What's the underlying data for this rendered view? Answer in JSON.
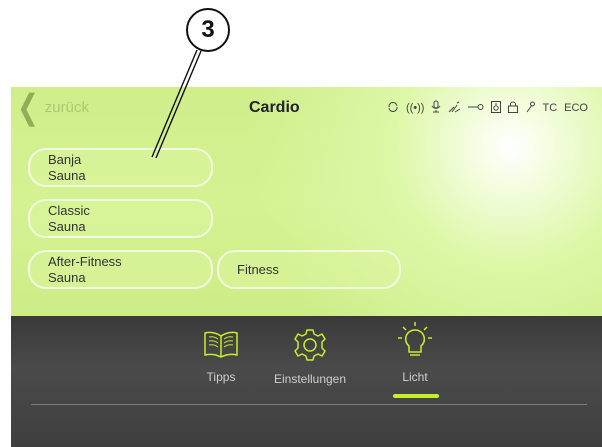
{
  "callout": {
    "number": "3"
  },
  "header": {
    "back_label": "zurück",
    "title": "Cardio",
    "status_icons": [
      "refresh-icon",
      "wifi-signal-icon",
      "microphone-icon",
      "scent-icon",
      "key-icon",
      "speaker-icon",
      "lock-icon",
      "wrench-icon",
      "tc-badge",
      "eco-badge"
    ],
    "tc_label": "TC",
    "eco_label": "ECO"
  },
  "programs": [
    {
      "line1": "Banja",
      "line2": "Sauna"
    },
    {
      "line1": "Classic",
      "line2": "Sauna"
    },
    {
      "line1": "After-Fitness",
      "line2": "Sauna"
    },
    {
      "line1": "Fitness",
      "line2": ""
    }
  ],
  "bottom_nav": {
    "items": [
      {
        "label": "Tipps",
        "icon": "book-icon"
      },
      {
        "label": "Einstellungen",
        "icon": "gear-icon"
      },
      {
        "label": "Licht",
        "icon": "lightbulb-icon",
        "active": true
      }
    ],
    "active_color": "#c5ef2a"
  },
  "colors": {
    "accent": "#d2f08f",
    "dark_panel": "#434343"
  }
}
